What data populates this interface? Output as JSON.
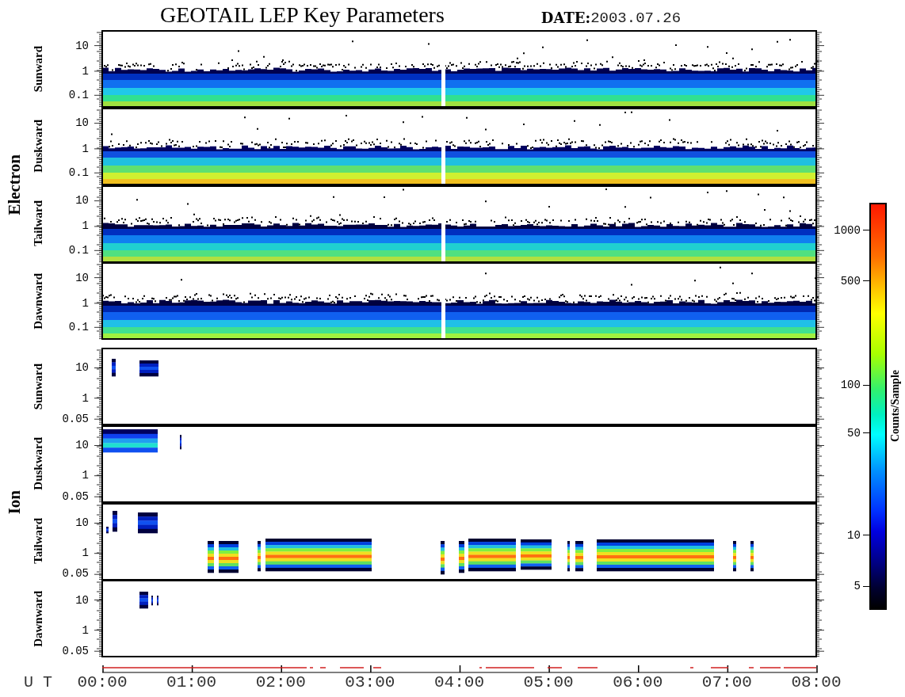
{
  "title": "GEOTAIL LEP Key Parameters",
  "date": {
    "label": "DATE:",
    "value": "2003.07.26"
  },
  "groups": [
    {
      "species": "Electron",
      "kind": "electron",
      "panels": [
        {
          "direction": "Sunward",
          "yticks": [
            "10",
            "1",
            "0.1"
          ]
        },
        {
          "direction": "Duskward",
          "yticks": [
            "10",
            "1",
            "0.1"
          ]
        },
        {
          "direction": "Tailward",
          "yticks": [
            "10",
            "1",
            "0.1"
          ]
        },
        {
          "direction": "Dawnward",
          "yticks": [
            "10",
            "1",
            "0.1"
          ]
        }
      ]
    },
    {
      "species": "Ion",
      "kind": "ion",
      "panels": [
        {
          "direction": "Sunward",
          "yticks": [
            "10",
            "1",
            "0.05"
          ]
        },
        {
          "direction": "Duskward",
          "yticks": [
            "10",
            "1",
            "0.05"
          ]
        },
        {
          "direction": "Tailward",
          "yticks": [
            "10",
            "1",
            "0.05"
          ]
        },
        {
          "direction": "Dawnward",
          "yticks": [
            "10",
            "1",
            "0.05"
          ]
        }
      ]
    }
  ],
  "x_axis": {
    "label": "U T",
    "ticks": [
      "00:00",
      "01:00",
      "02:00",
      "03:00",
      "04:00",
      "05:00",
      "06:00",
      "07:00",
      "08:00"
    ]
  },
  "colorbar": {
    "label": "Counts/Sample",
    "ticks": [
      "1000",
      "500",
      "100",
      "50",
      "10",
      "5"
    ]
  }
}
